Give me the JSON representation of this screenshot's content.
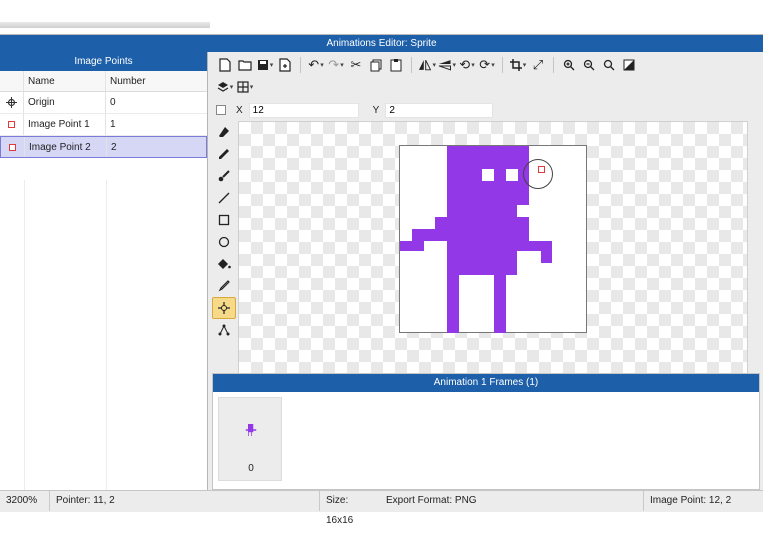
{
  "window": {
    "title": "Animations Editor: Sprite"
  },
  "image_points": {
    "title": "Image Points",
    "columns": {
      "name": "Name",
      "number": "Number"
    },
    "rows": [
      {
        "icon": "origin-crosshair-icon",
        "name": "Origin",
        "number": "0"
      },
      {
        "icon": "image-point-square-icon",
        "name": "Image Point 1",
        "number": "1"
      },
      {
        "icon": "image-point-square-icon",
        "name": "Image Point 2",
        "number": "2",
        "selected": true
      }
    ]
  },
  "coords": {
    "x_label": "X",
    "x_value": "12",
    "y_label": "Y",
    "y_value": "2"
  },
  "toolbar": {
    "icons": [
      "new-file-icon",
      "open-folder-icon",
      "save-icon",
      "export-icon",
      "undo-icon",
      "redo-icon",
      "cut-icon",
      "copy-icon",
      "paste-icon",
      "flip-icon",
      "mirror-icon",
      "rotate-left-icon",
      "rotate-right-icon",
      "crop-icon",
      "resize-icon",
      "zoom-in-icon",
      "zoom-out-icon",
      "zoom-reset-icon",
      "fill-contrast-icon",
      "layers-icon",
      "grid-icon"
    ]
  },
  "frames": {
    "title": "Animation 1 Frames (1)",
    "items": [
      {
        "number": "0"
      }
    ]
  },
  "status": {
    "zoom": "3200%",
    "pointer": "Pointer: 11, 2",
    "size": "Size: 16x16",
    "export_format": "Export Format: PNG",
    "image_point": "Image Point: 12, 2"
  },
  "colors": {
    "accent": "#1d5fa8",
    "sprite": "#9238e6",
    "selection": "#d6d6f5",
    "point_marker": "#e23a3a"
  }
}
